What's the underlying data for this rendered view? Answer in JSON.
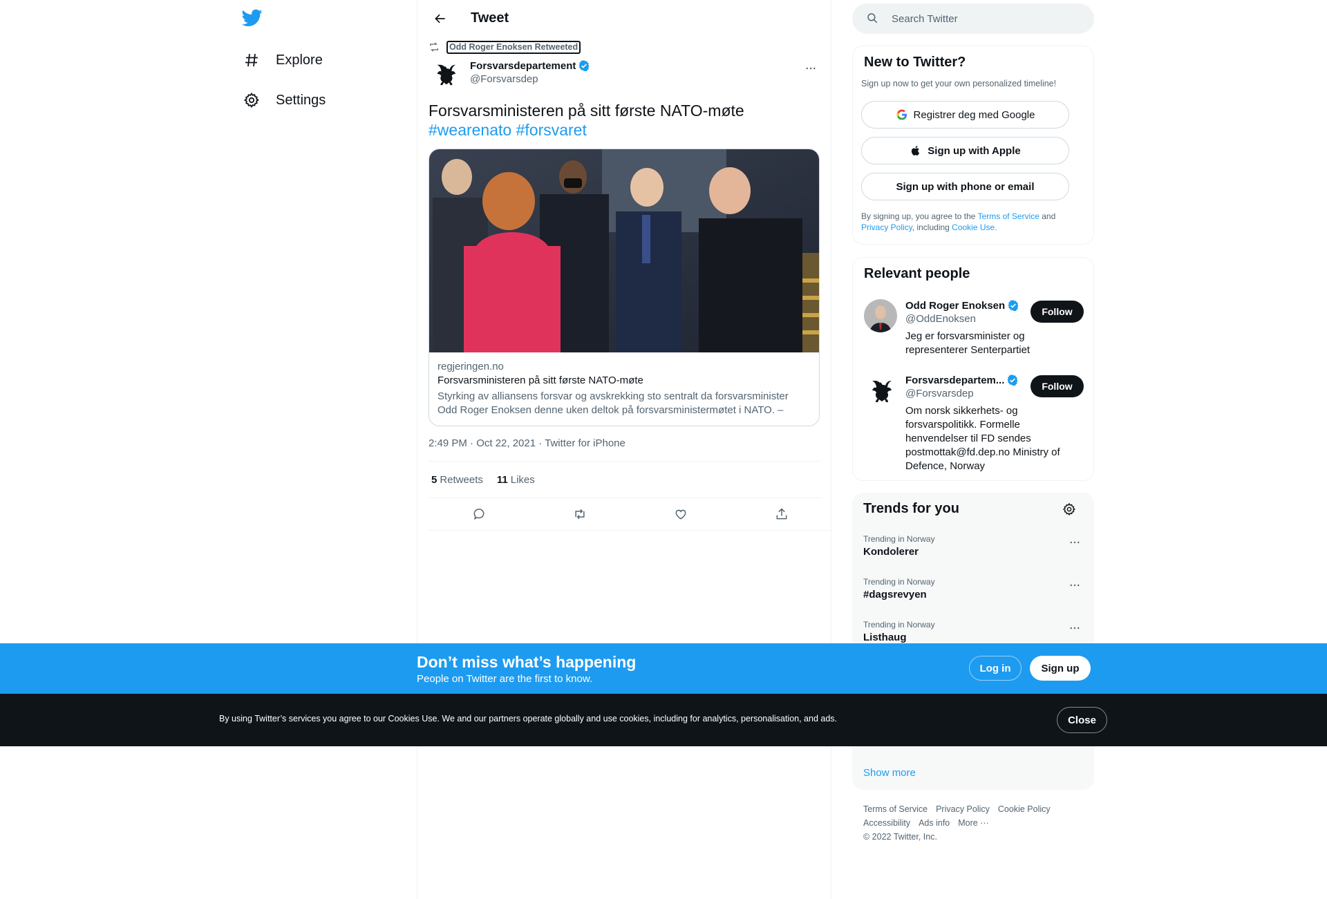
{
  "nav": {
    "explore_label": "Explore",
    "settings_label": "Settings"
  },
  "header": {
    "title": "Tweet"
  },
  "tweet": {
    "retweeted_by": "Odd Roger Enoksen Retweeted",
    "author_name": "Forsvarsdepartement",
    "author_handle": "@Forsvarsdep",
    "text": "Forsvarsministeren på sitt første NATO-møte",
    "hashtags": [
      "#wearenato",
      "#forsvaret"
    ],
    "card": {
      "domain": "regjeringen.no",
      "title": "Forsvarsministeren på sitt første NATO-møte",
      "description": "Styrking av alliansens forsvar og avskrekking sto sentralt da forsvarsminister Odd Roger Enoksen denne uken deltok på forsvarsministermøtet i NATO. – NATOs ..."
    },
    "timestamp": "2:49 PM · Oct 22, 2021 · Twitter for iPhone",
    "retweets_count": "5",
    "retweets_label": "Retweets",
    "likes_count": "11",
    "likes_label": "Likes"
  },
  "search": {
    "placeholder": "Search Twitter"
  },
  "new_to_twitter": {
    "title": "New to Twitter?",
    "subtitle": "Sign up now to get your own personalized timeline!",
    "google_label": "Registrer deg med Google",
    "apple_label": "Sign up with Apple",
    "phone_label": "Sign up with phone or email",
    "terms_prefix": "By signing up, you agree to the ",
    "terms_of_service": "Terms of Service",
    "terms_and": " and",
    "privacy_policy": "Privacy Policy",
    "terms_including": ", including ",
    "cookie_use": "Cookie Use."
  },
  "relevant_people": {
    "title": "Relevant people",
    "people": [
      {
        "name": "Odd Roger Enoksen",
        "handle": "@OddEnoksen",
        "bio": "Jeg er forsvarsminister og representerer Senterpartiet",
        "follow_label": "Follow"
      },
      {
        "name": "Forsvarsdepartem...",
        "handle": "@Forsvarsdep",
        "bio": "Om norsk sikkerhets- og forsvarspolitikk. Formelle henvendelser til FD sendes postmottak@fd.dep.no Ministry of Defence, Norway",
        "follow_label": "Follow"
      }
    ]
  },
  "trends": {
    "title": "Trends for you",
    "items": [
      {
        "category": "Trending in Norway",
        "name": "Kondolerer"
      },
      {
        "category": "Trending in Norway",
        "name": "#dagsrevyen"
      },
      {
        "category": "Trending in Norway",
        "name": "Listhaug"
      }
    ],
    "show_more": "Show more"
  },
  "footer": {
    "links": [
      "Terms of Service",
      "Privacy Policy",
      "Cookie Policy",
      "Accessibility",
      "Ads info",
      "More ···"
    ],
    "copyright": "© 2022 Twitter, Inc."
  },
  "banner": {
    "headline": "Don’t miss what’s happening",
    "subline": "People on Twitter are the first to know.",
    "login_label": "Log in",
    "signup_label": "Sign up"
  },
  "cookie_bar": {
    "text": "By using Twitter’s services you agree to our Cookies Use. We and our partners operate globally and use cookies, including for analytics, personalisation, and ads.",
    "close_label": "Close"
  },
  "colors": {
    "accent": "#1d9bf0",
    "text": "#0f1419",
    "secondary_text": "#536471",
    "cookie_bar": "#0f1419"
  },
  "icons": [
    "twitter-logo-icon",
    "hashtag-icon",
    "gear-icon",
    "back-arrow-icon",
    "retweet-icon",
    "verified-badge-icon",
    "more-icon",
    "reply-icon",
    "like-icon",
    "share-icon",
    "search-icon",
    "google-icon",
    "apple-icon"
  ]
}
